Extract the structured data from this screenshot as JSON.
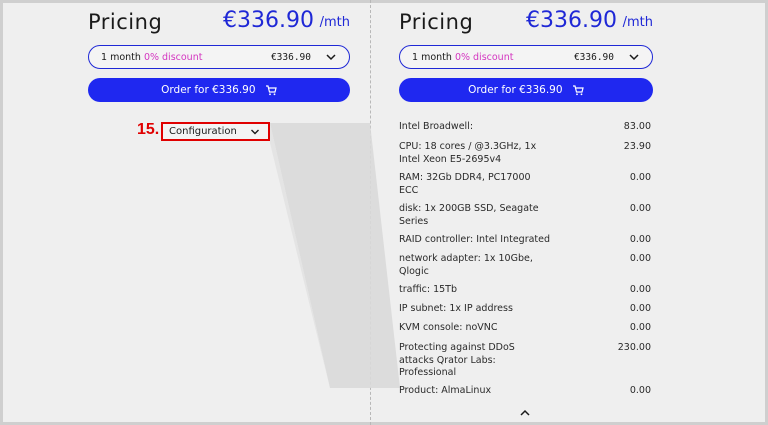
{
  "left_panel": {
    "title": "Pricing",
    "price": "€336.90",
    "unit": "/mth",
    "period_select": {
      "label": "1 month",
      "discount": "0% discount",
      "amount": "€336.90"
    },
    "order_button": "Order for  €336.90",
    "step_number": "15.",
    "config_toggle": "Configuration"
  },
  "right_panel": {
    "title": "Pricing",
    "price": "€336.90",
    "unit": "/mth",
    "period_select": {
      "label": "1 month",
      "discount": "0% discount",
      "amount": "€336.90"
    },
    "order_button": "Order for  €336.90",
    "config_items": [
      {
        "name": "Intel Broadwell:",
        "value": "83.00"
      },
      {
        "name": "CPU: 18 cores / @3.3GHz, 1x Intel Xeon E5-2695v4",
        "value": "23.90"
      },
      {
        "name": "RAM: 32Gb DDR4, PC17000 ECC",
        "value": "0.00"
      },
      {
        "name": "disk: 1x 200GB SSD, Seagate Series",
        "value": "0.00"
      },
      {
        "name": "RAID controller: Intel Integrated",
        "value": "0.00"
      },
      {
        "name": "network adapter: 1x 10Gbe, Qlogic",
        "value": "0.00"
      },
      {
        "name": "traffic: 15Tb",
        "value": "0.00"
      },
      {
        "name": "IP subnet: 1x IP address",
        "value": "0.00"
      },
      {
        "name": "KVM console: noVNC",
        "value": "0.00"
      },
      {
        "name": "Protecting against DDoS attacks Qrator Labs: Professional",
        "value": "230.00"
      },
      {
        "name": "Product: AlmaLinux",
        "value": "0.00"
      }
    ]
  },
  "colors": {
    "accent": "#1f28f0",
    "discount": "#d436c0",
    "highlight": "#e00000"
  },
  "icons": [
    "chevron-down-icon",
    "cart-icon",
    "chevron-up-icon"
  ]
}
